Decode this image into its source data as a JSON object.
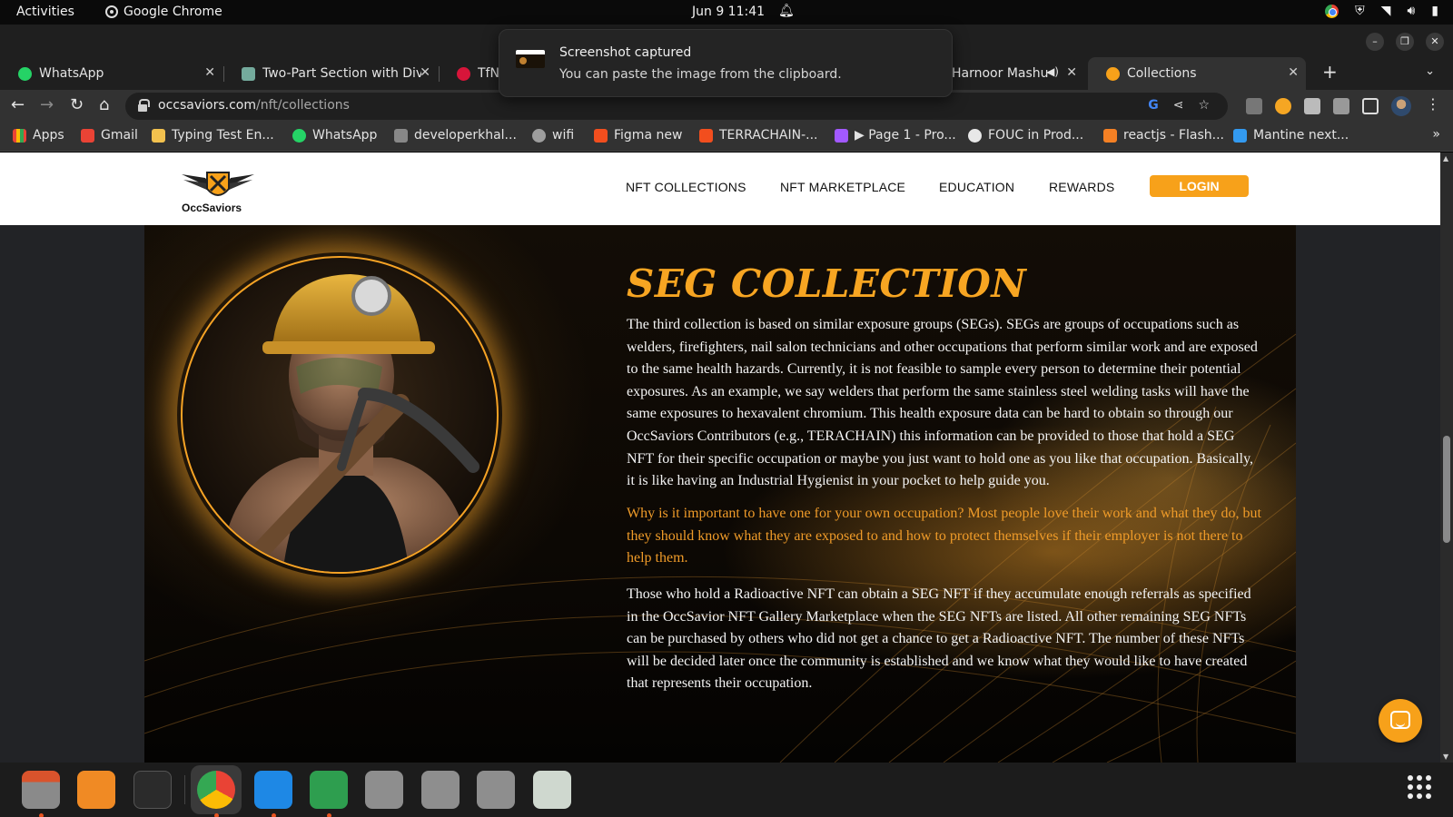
{
  "system_bar": {
    "activities": "Activities",
    "app_name": "Google Chrome",
    "clock": "Jun 9  11:41"
  },
  "notification": {
    "title": "Screenshot captured",
    "body": "You can paste the image from the clipboard."
  },
  "tabs": [
    {
      "label": "WhatsApp",
      "icon": "whatsapp-icon",
      "color": "#25d366"
    },
    {
      "label": "Two-Part Section with Div",
      "icon": "chatgpt-icon",
      "color": "#74aa9c"
    },
    {
      "label": "TfN",
      "icon": "nsw-icon",
      "color": "#d7153a"
    },
    {
      "label": "Harnoor Mashu",
      "icon": "youtube-icon",
      "color": "#ff0000"
    },
    {
      "label": "Collections",
      "icon": "occsaviors-icon",
      "color": "#f7a11a"
    }
  ],
  "address_bar": {
    "domain": "occsaviors.com",
    "path": "/nft/collections"
  },
  "bookmarks": [
    {
      "label": "Apps",
      "color": "#4285f4"
    },
    {
      "label": "Gmail",
      "color": "#ea4335"
    },
    {
      "label": "Typing Test En...",
      "color": "#f2c14e"
    },
    {
      "label": "WhatsApp",
      "color": "#25d366"
    },
    {
      "label": "developerkhal...",
      "color": "#888888"
    },
    {
      "label": "wifi",
      "color": "#9e9e9e"
    },
    {
      "label": "Figma new",
      "color": "#f24e1e"
    },
    {
      "label": "TERRACHAIN-...",
      "color": "#f24e1e"
    },
    {
      "label": "▶ Page 1 - Pro...",
      "color": "#a259ff"
    },
    {
      "label": "FOUC in Prod...",
      "color": "#e8e8e8"
    },
    {
      "label": "reactjs - Flash...",
      "color": "#f48024"
    },
    {
      "label": "Mantine next...",
      "color": "#339af0"
    }
  ],
  "site": {
    "logo_text": "OccSaviors",
    "nav": [
      "NFT COLLECTIONS",
      "NFT MARKETPLACE",
      "EDUCATION",
      "REWARDS"
    ],
    "login_label": "LOGIN",
    "brand_color": "#f7a11a"
  },
  "section": {
    "title": "SEG COLLECTION",
    "paragraphs": [
      "The third collection is based on similar exposure groups (SEGs). SEGs are groups of occupations such as welders, firefighters, nail salon technicians and other occupations that perform similar work and are exposed to the same health hazards. Currently, it is not feasible to sample every person to determine their potential exposures. As an example, we say welders that perform the same stainless steel welding tasks will have the same exposures to hexavalent chromium. This health exposure data can be hard to obtain so through our OccSaviors Contributors (e.g., TERACHAIN) this information can be provided to those that hold a SEG NFT for their specific occupation or maybe you just want to hold one as you like that occupation. Basically, it is like having an Industrial Hygienist in your pocket to help guide you.",
      "Why is it important to have one for your own occupation? Most people love their work and what they do, but they should know what they are exposed to and how to protect themselves if their employer is not there to help them.",
      "Those who hold a Radioactive NFT can obtain a SEG NFT if they accumulate enough referrals as specified in the OccSavior NFT Gallery Marketplace when the SEG NFTs are listed. All other remaining SEG NFTs can be purchased by others who did not get a chance to get a Radioactive NFT. The number of these NFTs will be decided later once the community is established and we know what they would like to have created that represents their occupation."
    ]
  },
  "dock": [
    "files-icon",
    "software-icon",
    "terminal-icon",
    "chrome-icon",
    "vscode-icon",
    "spreadsheet-icon",
    "disk-icon",
    "disk-icon",
    "disk-icon",
    "trash-icon"
  ]
}
